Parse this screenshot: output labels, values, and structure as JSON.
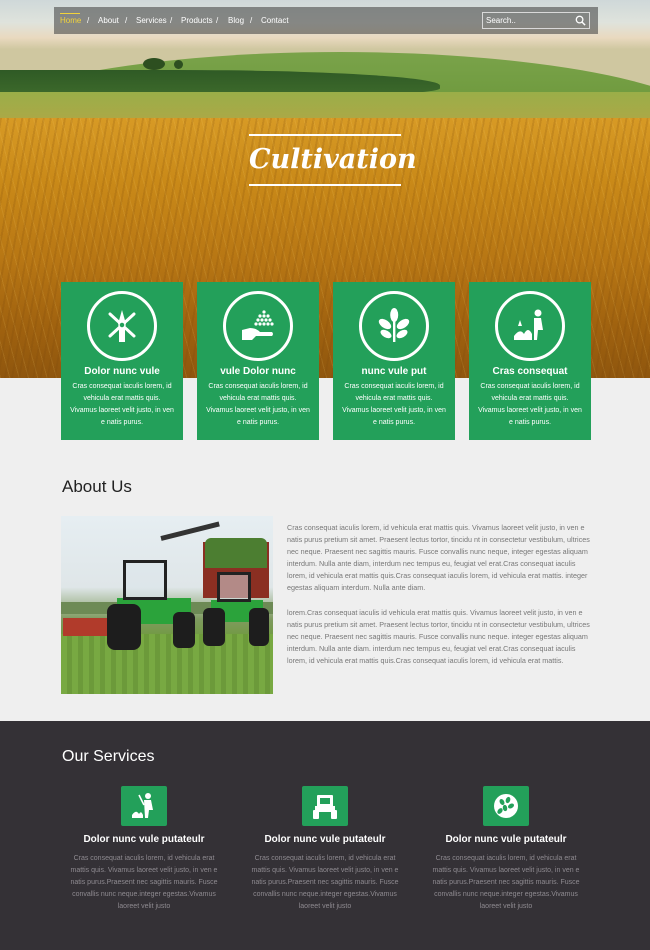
{
  "nav": {
    "items": [
      {
        "label": "Home",
        "active": true
      },
      {
        "label": "About",
        "active": false
      },
      {
        "label": "Services",
        "active": false
      },
      {
        "label": "Products",
        "active": false
      },
      {
        "label": "Blog",
        "active": false
      },
      {
        "label": "Contact",
        "active": false
      }
    ],
    "separator": "/",
    "search_placeholder": "Search..",
    "active_color": "#f2d33a"
  },
  "hero": {
    "title": "Cultivation"
  },
  "features": [
    {
      "icon": "windmill-icon",
      "title": "Dolor nunc vule",
      "text": "Cras consequat iaculis lorem, id vehicula erat mattis quis. Vivamus laoreet velit justo, in ven e natis purus."
    },
    {
      "icon": "hand-seeds-icon",
      "title": "vule Dolor nunc",
      "text": "Cras consequat iaculis lorem, id vehicula erat mattis quis. Vivamus laoreet velit justo, in ven e natis purus."
    },
    {
      "icon": "plant-sprout-icon",
      "title": "nunc vule put",
      "text": "Cras consequat iaculis lorem, id vehicula erat mattis quis. Vivamus laoreet velit justo, in ven e natis purus."
    },
    {
      "icon": "gardener-icon",
      "title": "Cras consequat",
      "text": "Cras consequat iaculis lorem, id vehicula erat mattis quis. Vivamus laoreet velit justo, in ven e natis purus."
    }
  ],
  "about": {
    "heading": "About Us",
    "image": "tractors-photo",
    "paragraphs": [
      "Cras consequat iaculis lorem, id vehicula erat mattis quis. Vivamus laoreet velit justo, in ven e natis purus pretium sit amet. Praesent lectus tortor, tincidu nt in consectetur vestibulum, ultrices nec neque. Praesent nec sagittis mauris. Fusce convallis nunc neque, integer egestas aliquam interdum. Nulla ante diam, interdum nec tempus eu, feugiat vel erat.Cras consequat iaculis lorem, id vehicula erat mattis quis.Cras consequat iaculis lorem, id vehicula erat mattis. integer egestas aliquam interdum. Nulla ante diam.",
      "lorem.Cras consequat iaculis id vehicula erat mattis quis. Vivamus laoreet velit justo, in ven e natis purus pretium sit amet. Praesent lectus tortor, tincidu nt in consectetur vestibulum, ultrices nec neque. Praesent nec sagittis mauris. Fusce convallis nunc neque. integer egestas aliquam interdum. Nulla ante diam. interdum nec tempus eu, feugiat vel erat.Cras consequat iaculis lorem, id vehicula erat mattis quis.Cras consequat iaculis lorem, id vehicula erat mattis."
    ]
  },
  "services": {
    "heading": "Our Services",
    "items": [
      {
        "icon": "farmer-icon",
        "title": "Dolor nunc vule putateulr",
        "text": "Cras consequat iaculis lorem, id vehicula erat mattis quis. Vivamus laoreet velit justo, in ven e natis purus.Praesent nec sagittis mauris. Fusce convallis nunc neque.integer egestas.Vivamus laoreet velit justo"
      },
      {
        "icon": "tractor-icon",
        "title": "Dolor nunc vule putateulr",
        "text": "Cras consequat iaculis lorem, id vehicula erat mattis quis. Vivamus laoreet velit justo, in ven e natis purus.Praesent nec sagittis mauris. Fusce convallis nunc neque.integer egestas.Vivamus laoreet velit justo"
      },
      {
        "icon": "grain-icon",
        "title": "Dolor nunc vule putateulr",
        "text": "Cras consequat iaculis lorem, id vehicula erat mattis quis. Vivamus laoreet velit justo, in ven e natis purus.Praesent nec sagittis mauris. Fusce convallis nunc neque.integer egestas.Vivamus laoreet velit justo"
      }
    ]
  },
  "colors": {
    "accent_green": "#23a05a",
    "dark_section": "#343136",
    "page_background": "#efefef"
  }
}
